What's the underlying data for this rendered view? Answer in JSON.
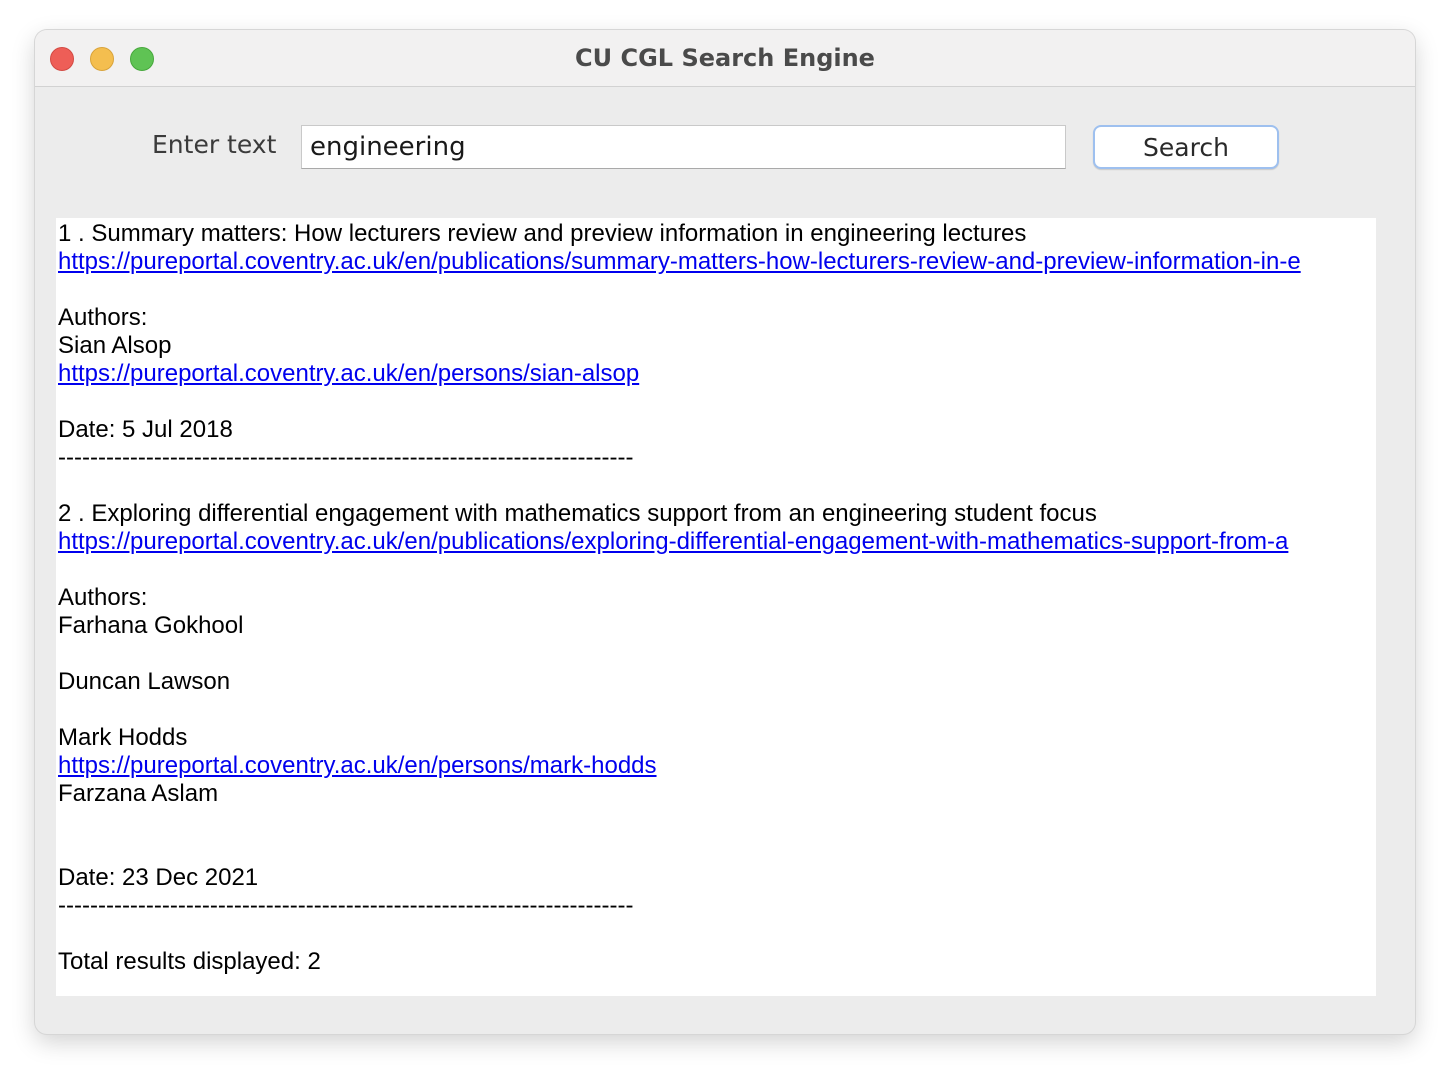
{
  "window": {
    "title": "CU CGL Search Engine"
  },
  "search": {
    "label": "Enter text",
    "value": "engineering",
    "button_label": "Search"
  },
  "results": {
    "items": [
      {
        "title": "1 . Summary matters: How lecturers review and preview information in engineering lectures",
        "url": "https://pureportal.coventry.ac.uk/en/publications/summary-matters-how-lecturers-review-and-preview-information-in-e",
        "authors_label": "Authors:",
        "author_1": "Sian Alsop",
        "author_1_url": "https://pureportal.coventry.ac.uk/en/persons/sian-alsop",
        "date": "Date:  5 Jul 2018",
        "separator": "------------------------------------------------------------------------"
      },
      {
        "title": "2 . Exploring differential engagement with mathematics support from an engineering student focus",
        "url": "https://pureportal.coventry.ac.uk/en/publications/exploring-differential-engagement-with-mathematics-support-from-a",
        "authors_label": "Authors:",
        "author_1": "Farhana Gokhool",
        "author_2": "Duncan Lawson",
        "author_3": "Mark Hodds",
        "author_3_url": "https://pureportal.coventry.ac.uk/en/persons/mark-hodds",
        "author_4": "Farzana Aslam",
        "date": "Date:  23 Dec 2021",
        "separator": "------------------------------------------------------------------------"
      }
    ],
    "total": "Total results displayed:  2"
  }
}
